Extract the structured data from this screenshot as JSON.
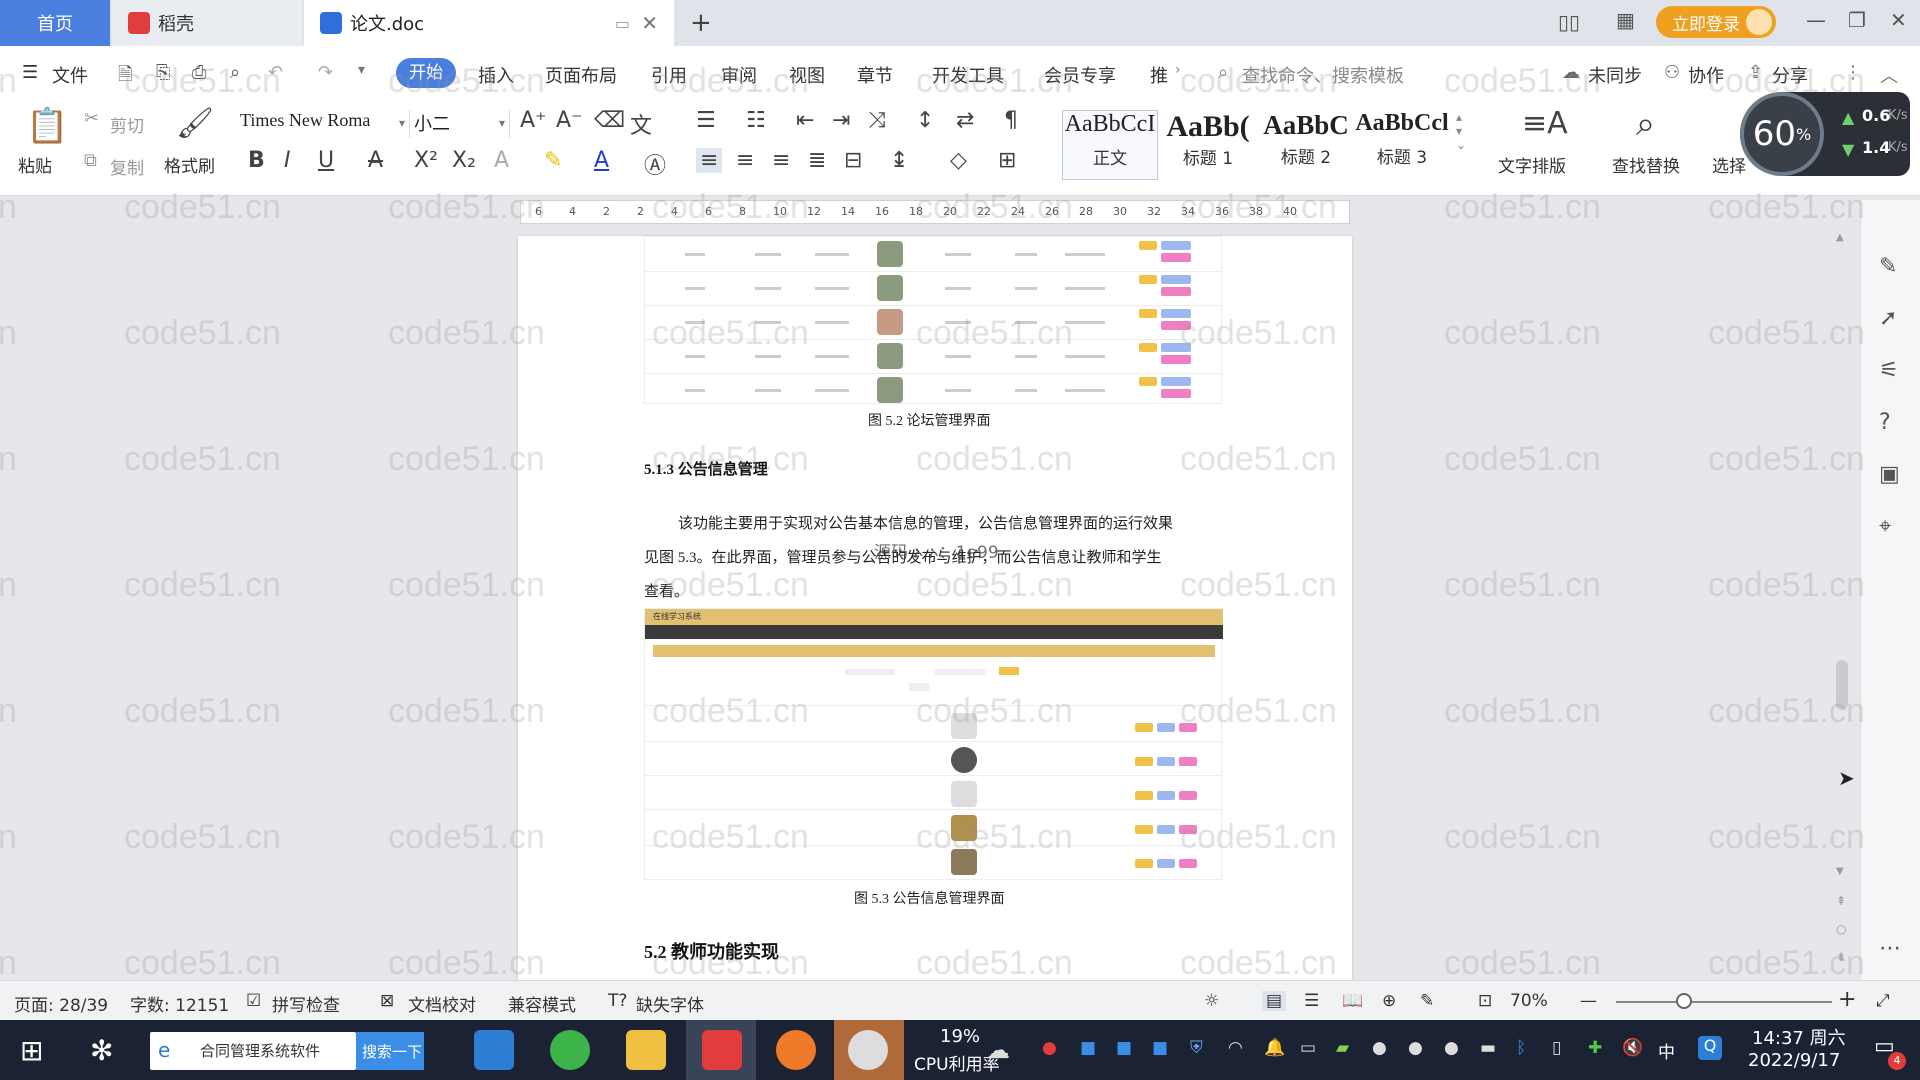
{
  "tabs": {
    "home": "首页",
    "docer": "稻壳",
    "doc": "论文.doc",
    "login": "立即登录"
  },
  "menu": {
    "file": "文件",
    "items": [
      "开始",
      "插入",
      "页面布局",
      "引用",
      "审阅",
      "视图",
      "章节",
      "开发工具",
      "会员专享",
      "推"
    ],
    "search_command": "查找命令、搜索模板",
    "unsynced": "未同步",
    "collab": "协作",
    "share": "分享"
  },
  "ribbon": {
    "paste": "粘贴",
    "cut": "剪切",
    "copy": "复制",
    "format_painter": "格式刷",
    "font_name": "Times New Roma",
    "font_size": "小二",
    "styles": [
      {
        "sample": "AaBbCcI",
        "name": "正文"
      },
      {
        "sample": "AaBb(",
        "name": "标题 1"
      },
      {
        "sample": "AaBbC",
        "name": "标题 2"
      },
      {
        "sample": "AaBbCcl",
        "name": "标题 3"
      }
    ],
    "text_layout": "文字排版",
    "find_replace": "查找替换",
    "select": "选择"
  },
  "speed": {
    "percent": "60",
    "percent_unit": "%",
    "up": "0.6",
    "up_unit": "K/s",
    "down": "1.4",
    "down_unit": "K/s"
  },
  "ruler": {
    "ticks": [
      "6",
      "4",
      "2",
      "2",
      "4",
      "6",
      "8",
      "10",
      "12",
      "14",
      "16",
      "18",
      "20",
      "22",
      "24",
      "26",
      "28",
      "30",
      "32",
      "34",
      "36",
      "38",
      "40"
    ]
  },
  "document": {
    "fig52_caption": "图 5.2  论坛管理界面",
    "sec_513": "5.1.3  公告信息管理",
    "para_line1": "该功能主要用于实现对公告基本信息的管理，公告信息管理界面的运行效果",
    "para_line2": "见图 5.3。在此界面，管理员参与公告的发布与维护，而公告信息让教师和学生",
    "para_line3": "查看。",
    "overlay_text": "源码 ኦ ኦ：1e99",
    "fig53_header": "在线学习系统",
    "fig53_caption": "图 5.3  公告信息管理界面",
    "sec_52": "5.2  教师功能实现"
  },
  "watermark": "code51.cn",
  "status": {
    "page": "页面: 28/39",
    "words": "字数: 12151",
    "spell": "拼写检查",
    "proof": "文档校对",
    "compat": "兼容模式",
    "missing_font": "缺失字体",
    "zoom": "70%"
  },
  "taskbar": {
    "search_text": "合同管理系统软件",
    "search_btn": "搜索一下",
    "cpu_pct": "19%",
    "cpu_label": "CPU利用率",
    "ime": "中",
    "time": "14:37 周六",
    "date": "2022/9/17",
    "notif_count": "4"
  },
  "colors": {
    "accent": "#4a7fe0",
    "login": "#f0a020",
    "taskbar": "#1a2233"
  }
}
